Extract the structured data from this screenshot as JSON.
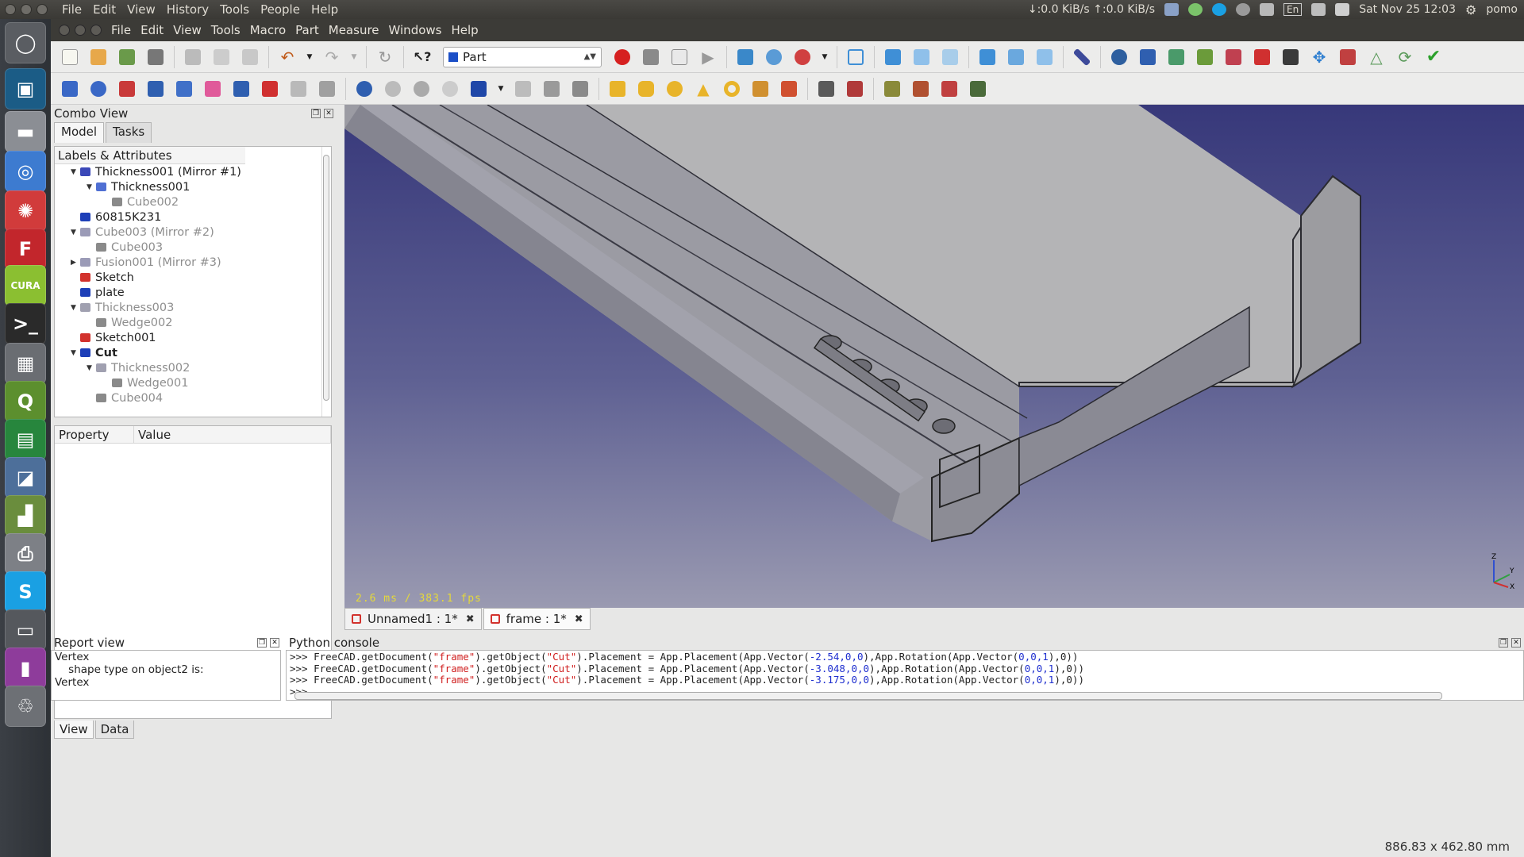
{
  "system_bar": {
    "menu": [
      "File",
      "Edit",
      "View",
      "History",
      "Tools",
      "People",
      "Help"
    ],
    "net_down": "↓:0.0 KiB/s",
    "net_up": "↑:0.0 KiB/s",
    "lang": "En",
    "datetime": "Sat Nov 25 12:03",
    "user": "pomo"
  },
  "launcher": [
    {
      "name": "ubuntu-dash",
      "glyph": "◯",
      "color": "#5a5d62"
    },
    {
      "name": "image-viewer",
      "glyph": "▣",
      "color": "#1b5c86"
    },
    {
      "name": "disk",
      "glyph": "▬",
      "color": "#8b8e94"
    },
    {
      "name": "chromium",
      "glyph": "◎",
      "color": "#3d7bd0"
    },
    {
      "name": "settings",
      "glyph": "✺",
      "color": "#d13b3b"
    },
    {
      "name": "freecad",
      "glyph": "F",
      "color": "#c2262c"
    },
    {
      "name": "cura",
      "glyph": "CURA",
      "color": "#8bbf31"
    },
    {
      "name": "terminal",
      "glyph": ">_",
      "color": "#2a2a2a"
    },
    {
      "name": "calculator",
      "glyph": "▦",
      "color": "#6a6d72"
    },
    {
      "name": "qgis",
      "glyph": "Q",
      "color": "#5c8f2e"
    },
    {
      "name": "spreadsheet",
      "glyph": "▤",
      "color": "#27863d"
    },
    {
      "name": "projector",
      "glyph": "◪",
      "color": "#4d6f9a"
    },
    {
      "name": "chart-app",
      "glyph": "▟",
      "color": "#6a8d3d"
    },
    {
      "name": "printer",
      "glyph": "⎙",
      "color": "#7d8086"
    },
    {
      "name": "skype",
      "glyph": "S",
      "color": "#1aa0e3"
    },
    {
      "name": "window",
      "glyph": "▭",
      "color": "#55585d"
    },
    {
      "name": "presentation",
      "glyph": "▮",
      "color": "#8e3c9b"
    },
    {
      "name": "trash",
      "glyph": "♲",
      "color": "#6d7075"
    }
  ],
  "menubar": [
    "File",
    "Edit",
    "View",
    "Tools",
    "Macro",
    "Part",
    "Measure",
    "Windows",
    "Help"
  ],
  "workbench": "Part",
  "combo": {
    "title": "Combo View",
    "tabs": [
      "Model",
      "Tasks"
    ],
    "tree_header": "Labels & Attributes",
    "tree": [
      {
        "label": "Thickness001 (Mirror #1)",
        "indent": 1,
        "arrow": "▼",
        "icon": "#3b48b8",
        "muted": false,
        "bold": false
      },
      {
        "label": "Thickness001",
        "indent": 2,
        "arrow": "▼",
        "icon": "#4f6fd3",
        "muted": false,
        "bold": false
      },
      {
        "label": "Cube002",
        "indent": 3,
        "arrow": "",
        "icon": "#8a8a8a",
        "muted": true,
        "bold": false
      },
      {
        "label": "60815K231",
        "indent": 1,
        "arrow": "",
        "icon": "#1d3fb8",
        "muted": false,
        "bold": false
      },
      {
        "label": "Cube003 (Mirror #2)",
        "indent": 1,
        "arrow": "▼",
        "icon": "#9b9bb7",
        "muted": true,
        "bold": false
      },
      {
        "label": "Cube003",
        "indent": 2,
        "arrow": "",
        "icon": "#8a8a8a",
        "muted": true,
        "bold": false
      },
      {
        "label": "Fusion001 (Mirror #3)",
        "indent": 1,
        "arrow": "▶",
        "icon": "#9b9bb7",
        "muted": true,
        "bold": false
      },
      {
        "label": "Sketch",
        "indent": 1,
        "arrow": "",
        "icon": "#d2322d",
        "muted": false,
        "bold": false
      },
      {
        "label": "plate",
        "indent": 1,
        "arrow": "",
        "icon": "#1d3fb8",
        "muted": false,
        "bold": false
      },
      {
        "label": "Thickness003",
        "indent": 1,
        "arrow": "▼",
        "icon": "#a0a0b0",
        "muted": true,
        "bold": false
      },
      {
        "label": "Wedge002",
        "indent": 2,
        "arrow": "",
        "icon": "#8a8a8a",
        "muted": true,
        "bold": false
      },
      {
        "label": "Sketch001",
        "indent": 1,
        "arrow": "",
        "icon": "#d2322d",
        "muted": false,
        "bold": false
      },
      {
        "label": "Cut",
        "indent": 1,
        "arrow": "▼",
        "icon": "#1d3fb8",
        "muted": false,
        "bold": true
      },
      {
        "label": "Thickness002",
        "indent": 2,
        "arrow": "▼",
        "icon": "#a0a0b0",
        "muted": true,
        "bold": false
      },
      {
        "label": "Wedge001",
        "indent": 3,
        "arrow": "",
        "icon": "#8a8a8a",
        "muted": true,
        "bold": false
      },
      {
        "label": "Cube004",
        "indent": 2,
        "arrow": "",
        "icon": "#8a8a8a",
        "muted": true,
        "bold": false
      }
    ],
    "prop_headers": [
      "Property",
      "Value"
    ],
    "prop_tabs": [
      "View",
      "Data"
    ]
  },
  "view3d": {
    "fps": "2.6 ms / 383.1 fps",
    "axes": [
      "Z",
      "Y",
      "X"
    ]
  },
  "doc_tabs": [
    "Unnamed1 : 1*",
    "frame : 1*"
  ],
  "report": {
    "title": "Report view",
    "lines": [
      "Vertex",
      "    shape type on object2 is:",
      "Vertex"
    ]
  },
  "python": {
    "title": "Python console",
    "lines": [
      {
        "pre": ">>> FreeCAD.getDocument(",
        "s1": "\"frame\"",
        "mid": ").getObject(",
        "s2": "\"Cut\"",
        "post1": ").Placement = App.Placement(App.Vector(",
        "n1": "-2.54,0,0",
        "post2": "),App.Rotation(App.Vector(",
        "n2": "0,0,1",
        "post3": "),0))"
      },
      {
        "pre": ">>> FreeCAD.getDocument(",
        "s1": "\"frame\"",
        "mid": ").getObject(",
        "s2": "\"Cut\"",
        "post1": ").Placement = App.Placement(App.Vector(",
        "n1": "-3.048,0,0",
        "post2": "),App.Rotation(App.Vector(",
        "n2": "0,0,1",
        "post3": "),0))"
      },
      {
        "pre": ">>> FreeCAD.getDocument(",
        "s1": "\"frame\"",
        "mid": ").getObject(",
        "s2": "\"Cut\"",
        "post1": ").Placement = App.Placement(App.Vector(",
        "n1": "-3.175,0,0",
        "post2": "),App.Rotation(App.Vector(",
        "n2": "0,0,1",
        "post3": "),0))"
      }
    ],
    "prompt": ">>>"
  },
  "status": "886.83 x 462.80 mm"
}
